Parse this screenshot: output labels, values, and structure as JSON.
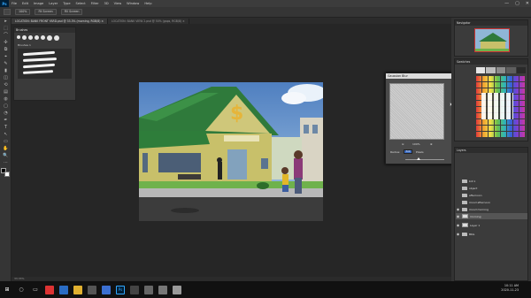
{
  "app": {
    "logo": "Ps",
    "menu": [
      "File",
      "Edit",
      "Image",
      "Layer",
      "Type",
      "Select",
      "Filter",
      "3D",
      "View",
      "Window",
      "Help"
    ],
    "window_controls": [
      "—",
      "▢",
      "✕"
    ]
  },
  "options_bar": {
    "size_value": "100%",
    "sample_button": "Fit Screen",
    "fill_button": "Fill Screen"
  },
  "tabs": [
    {
      "label": "LOCATION: BANK FRONT YARD.psd @ 33.3% (morning, RGB/8) ×",
      "active": true
    },
    {
      "label": "LOCATION: BANK VIEW 2.psd @ 50% (gaps, RGB/8) ×",
      "active": false
    }
  ],
  "toolbar": {
    "tools": [
      "▸",
      "⬚",
      "⌒",
      "✣",
      "⧉",
      "⌖",
      "✎",
      "▮",
      "◫",
      "⟲",
      "▤",
      "◍",
      "▢",
      "◔",
      "✒",
      "T",
      "↖",
      "▭",
      "✋",
      "🔍",
      "⋯"
    ]
  },
  "brushes_panel": {
    "title": "Brushes",
    "set_name": "Brushes 1"
  },
  "gaussian_blur": {
    "title": "Gaussian Blur",
    "ok_label": "OK",
    "cancel_label": "Cancel",
    "preview_label": "Preview",
    "zoom_value": "100%",
    "radius_label": "Radius:",
    "radius_value": "3.0",
    "unit_label": "Pixels"
  },
  "right_panels": {
    "navigator_title": "Navigator",
    "swatches_title": "Swatches",
    "layers_title": "Layers"
  },
  "layers": [
    {
      "name": "bill 1",
      "type": "folder",
      "selected": false
    },
    {
      "name": "object",
      "type": "folder",
      "selected": false
    },
    {
      "name": "afternoon",
      "type": "folder",
      "selected": false
    },
    {
      "name": "mood afternoon",
      "type": "folder",
      "selected": false
    },
    {
      "name": "mood morning",
      "type": "folder",
      "selected": false
    },
    {
      "name": "morning",
      "type": "layer",
      "selected": true
    },
    {
      "name": "Layer 1",
      "type": "layer",
      "selected": false
    },
    {
      "name": "BKG",
      "type": "folder",
      "selected": false
    }
  ],
  "status_bar": {
    "zoom": "33.33%"
  },
  "taskbar": {
    "time": "10:11 AM",
    "date": "2020-11-23",
    "apps": [
      "start-icon",
      "search-icon",
      "task-view-icon",
      "chrome-icon",
      "edge-icon",
      "file-explorer-icon",
      "store-icon",
      "mail-icon",
      "photoshop-icon",
      "media-icon",
      "app-icon",
      "app-icon-2",
      "app-icon-3"
    ]
  }
}
